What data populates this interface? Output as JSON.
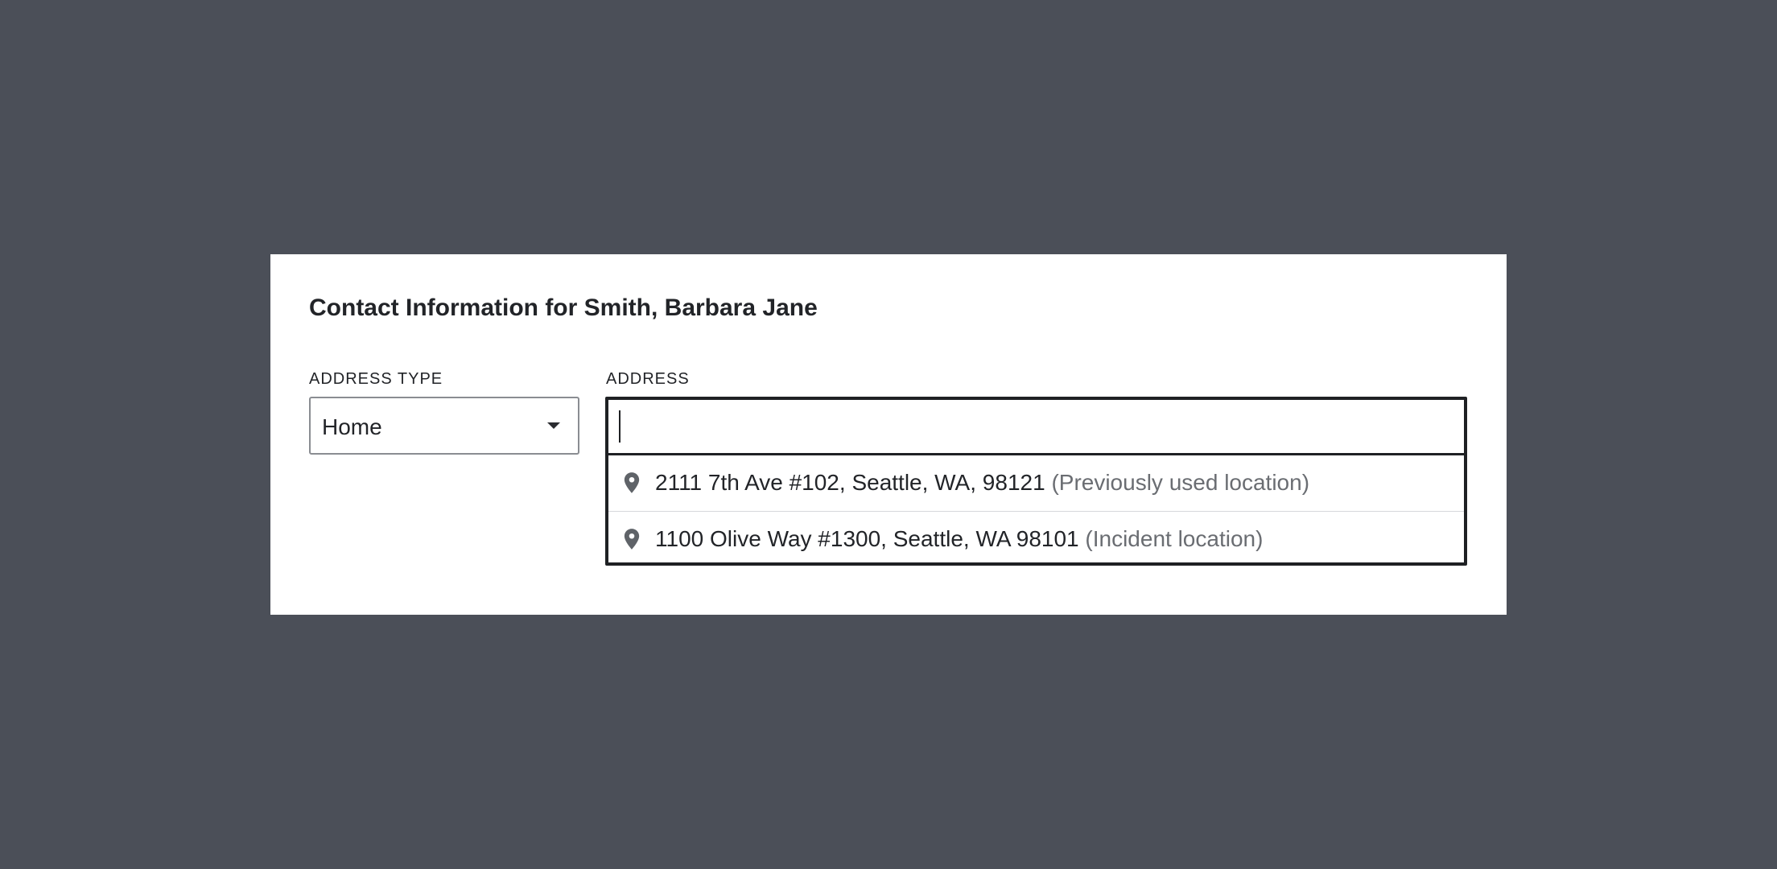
{
  "dialog": {
    "title": "Contact Information for Smith, Barbara Jane"
  },
  "address_type": {
    "label": "ADDRESS TYPE",
    "selected": "Home"
  },
  "address": {
    "label": "ADDRESS",
    "value": "",
    "suggestions": [
      {
        "icon": "map-pin-icon",
        "address": "2111 7th Ave #102, Seattle, WA, 98121",
        "note": "(Previously used location)"
      },
      {
        "icon": "map-pin-icon",
        "address": "1100 Olive Way #1300, Seattle, WA 98101",
        "note": "(Incident location)"
      }
    ]
  },
  "colors": {
    "background": "#4b4f58",
    "panel": "#ffffff",
    "text": "#222428",
    "secondary_text": "#6a6d72",
    "focus_border": "#1f2124"
  }
}
